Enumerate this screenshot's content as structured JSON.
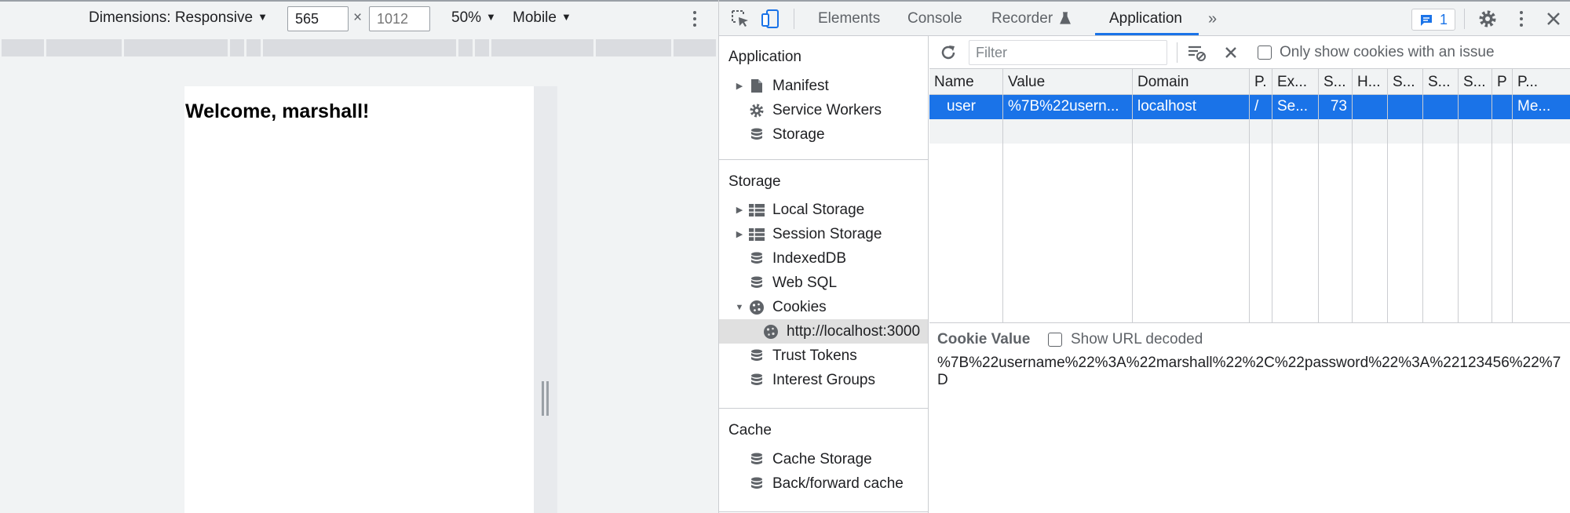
{
  "device_toolbar": {
    "dimensions_label": "Dimensions: Responsive",
    "width_value": "565",
    "height_placeholder": "1012",
    "times_symbol": "×",
    "zoom": "50%",
    "device_type": "Mobile"
  },
  "page": {
    "welcome_text": "Welcome, marshall!"
  },
  "devtools": {
    "tabs": [
      "Elements",
      "Console",
      "Recorder",
      "Application"
    ],
    "active_tab": "Application",
    "more_tabs": "»",
    "issues_count": "1"
  },
  "sidebar": {
    "application_heading": "Application",
    "application_items": [
      "Manifest",
      "Service Workers",
      "Storage"
    ],
    "storage_heading": "Storage",
    "storage_items": [
      "Local Storage",
      "Session Storage",
      "IndexedDB",
      "Web SQL",
      "Cookies",
      "http://localhost:3000",
      "Trust Tokens",
      "Interest Groups"
    ],
    "cache_heading": "Cache",
    "cache_items": [
      "Cache Storage",
      "Back/forward cache"
    ]
  },
  "cookies": {
    "filter_placeholder": "Filter",
    "only_issue_label": "Only show cookies with an issue",
    "columns": [
      "Name",
      "Value",
      "Domain",
      "P.",
      "Ex...",
      "S...",
      "H...",
      "S...",
      "S...",
      "S...",
      "P",
      "P..."
    ],
    "rows": [
      [
        "user",
        "%7B%22usern...",
        "localhost",
        "/",
        "Se...",
        "73",
        "",
        "",
        "",
        "",
        "",
        "Me..."
      ]
    ],
    "cookie_value_title": "Cookie Value",
    "show_url_decoded_label": "Show URL decoded",
    "cookie_value_text": "%7B%22username%22%3A%22marshall%22%2C%22password%22%3A%22123456%22%7D"
  },
  "colors": {
    "accent": "#1a73e8",
    "toolbar_bg": "#f1f3f4"
  }
}
